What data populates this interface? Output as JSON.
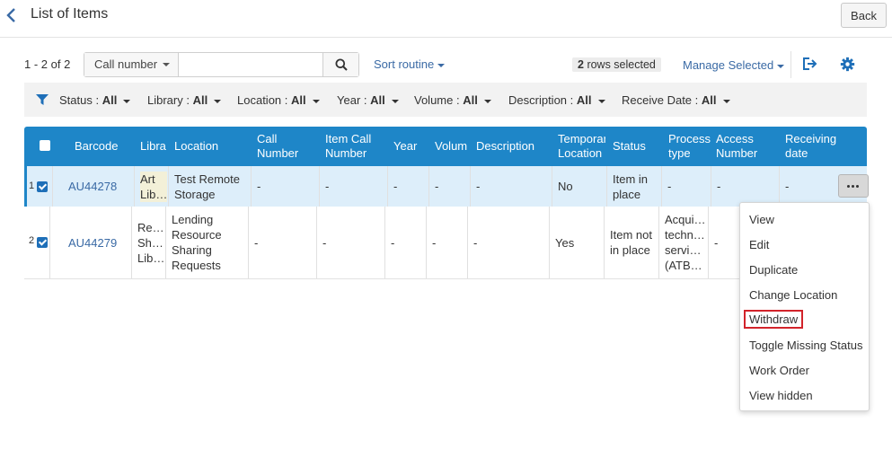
{
  "header": {
    "title": "List of Items",
    "back_label": "Back"
  },
  "toolbar": {
    "count": "1 - 2 of 2",
    "search_field": "Call number",
    "search_value": "",
    "sort_label": "Sort routine",
    "rows_selected_num": "2",
    "rows_selected_text": "rows selected",
    "manage_label": "Manage Selected"
  },
  "filters": [
    {
      "label": "Status :",
      "value": "All"
    },
    {
      "label": "Library :",
      "value": "All"
    },
    {
      "label": "Location :",
      "value": "All"
    },
    {
      "label": "Year :",
      "value": "All"
    },
    {
      "label": "Volume :",
      "value": "All"
    },
    {
      "label": "Description :",
      "value": "All"
    },
    {
      "label": "Receive Date :",
      "value": "All"
    }
  ],
  "table": {
    "columns": [
      "Barcode",
      "Libra",
      "Location",
      "Call\nNumber",
      "Item Call\nNumber",
      "Year",
      "Volum",
      "Description",
      "Temporar\nLocation",
      "Status",
      "Process\ntype",
      "Access\nNumber",
      "Receiving\ndate"
    ],
    "rows": [
      {
        "num": "1",
        "barcode": "AU44278",
        "library": "Art\nLib…",
        "location": "Test Remote\nStorage",
        "call_number": "-",
        "item_call_number": "-",
        "year": "-",
        "volume": "-",
        "description": "-",
        "temp_location": "No",
        "status": "Item in\nplace",
        "process_type": "-",
        "access_number": "-",
        "receiving_date": "-"
      },
      {
        "num": "2",
        "barcode": "AU44279",
        "library": "Re…\nSh…\nLib…",
        "location": "Lending\nResource\nSharing\nRequests",
        "call_number": "-",
        "item_call_number": "-",
        "year": "-",
        "volume": "-",
        "description": "-",
        "temp_location": "Yes",
        "status": "Item not\nin place",
        "process_type": "Acqui…\ntechn…\nservi…\n(ATB…",
        "access_number": "-",
        "receiving_date": ""
      }
    ]
  },
  "row_menu": [
    "View",
    "Edit",
    "Duplicate",
    "Change Location",
    "Withdraw",
    "Toggle Missing Status",
    "Work Order",
    "View hidden"
  ],
  "colors": {
    "header_blue": "#1e86c8",
    "link_blue": "#3a6aa5",
    "selected_row": "#ddeefa",
    "highlight_red": "#d2232a"
  }
}
